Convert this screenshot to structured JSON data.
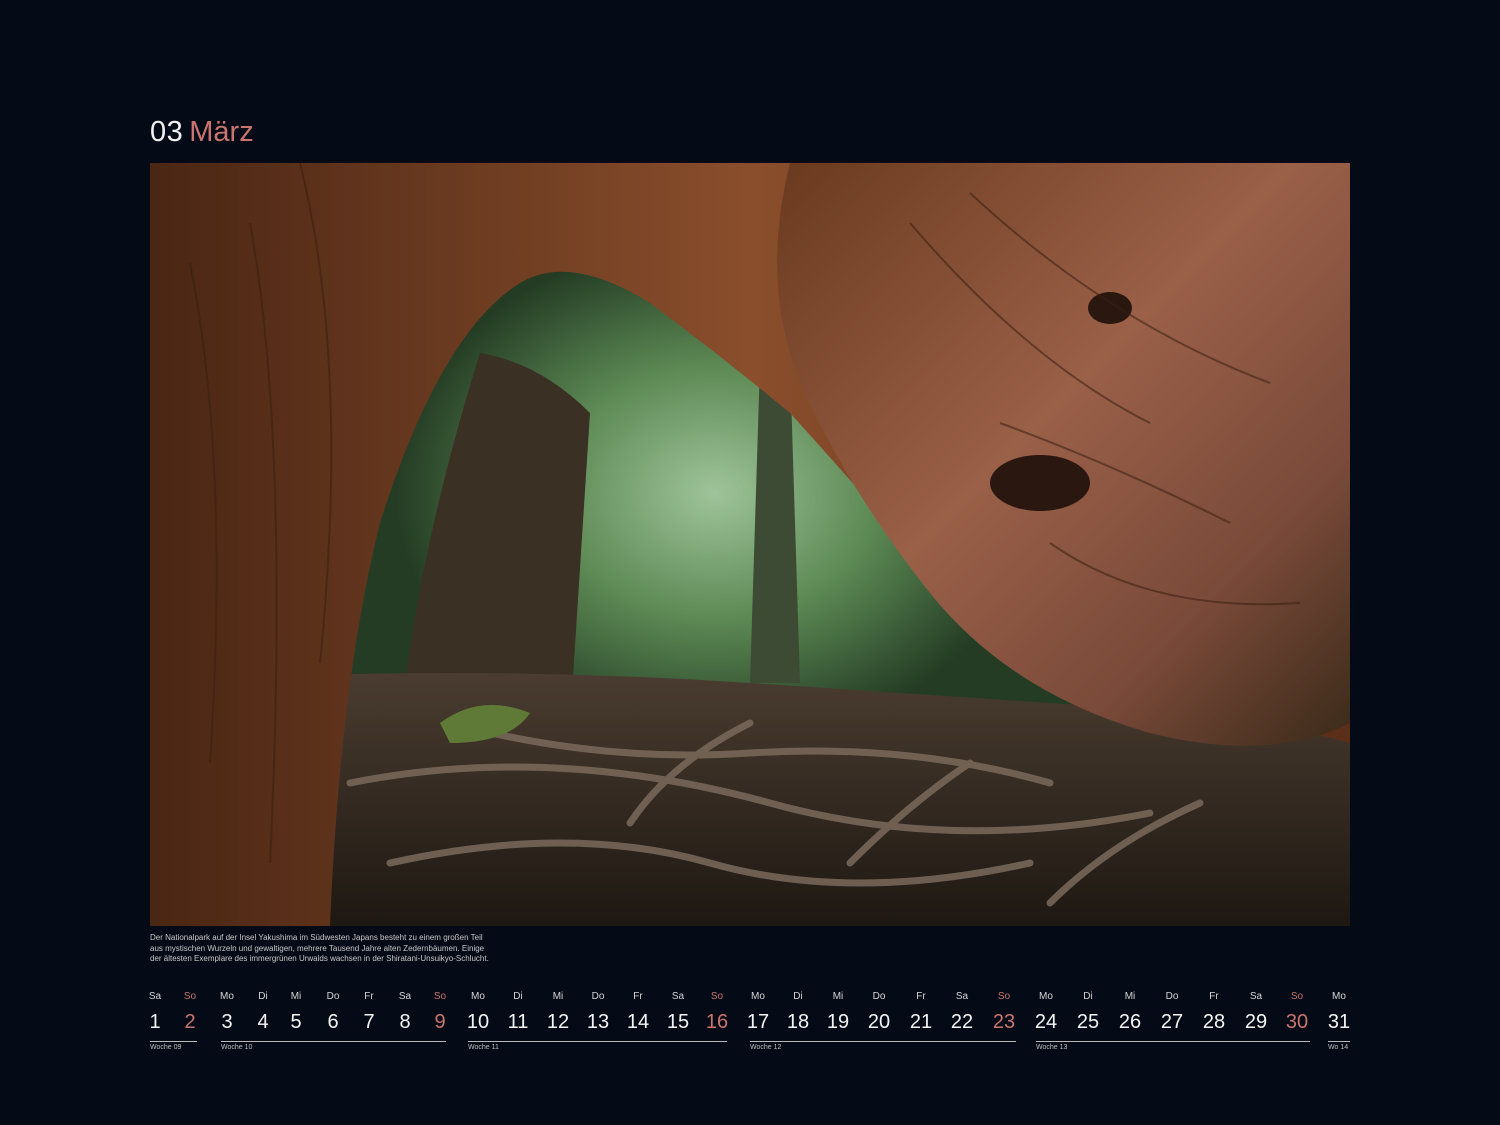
{
  "header": {
    "month_number": "03",
    "month_name": "März"
  },
  "photo": {
    "subject": "giant twisted cedar roots arching over a forest trail",
    "colors": {
      "bark": "#6b3a22",
      "foliage": "#4f7a44",
      "ground": "#3a2c22"
    }
  },
  "caption": [
    "Der Nationalpark auf der Insel Yakushima im Südwesten Japans besteht zu einem großen Teil",
    "aus mystischen Wurzeln und gewaltigen, mehrere Tausend Jahre alten Zedernbäumen. Einige",
    "der ältesten Exemplare des immergrünen Urwalds wachsen in der Shiratani-Unsuikyo-Schlucht."
  ],
  "colors": {
    "background": "#040b17",
    "accent_sunday": "#c9756d",
    "text": "#f4f4f4"
  },
  "calendar": {
    "days": [
      {
        "d": "Sa",
        "n": "1",
        "sun": false
      },
      {
        "d": "So",
        "n": "2",
        "sun": true
      },
      {
        "d": "Mo",
        "n": "3",
        "sun": false
      },
      {
        "d": "Di",
        "n": "4",
        "sun": false
      },
      {
        "d": "Mi",
        "n": "5",
        "sun": false
      },
      {
        "d": "Do",
        "n": "6",
        "sun": false
      },
      {
        "d": "Fr",
        "n": "7",
        "sun": false
      },
      {
        "d": "Sa",
        "n": "8",
        "sun": false
      },
      {
        "d": "So",
        "n": "9",
        "sun": true
      },
      {
        "d": "Mo",
        "n": "10",
        "sun": false
      },
      {
        "d": "Di",
        "n": "11",
        "sun": false
      },
      {
        "d": "Mi",
        "n": "12",
        "sun": false
      },
      {
        "d": "Do",
        "n": "13",
        "sun": false
      },
      {
        "d": "Fr",
        "n": "14",
        "sun": false
      },
      {
        "d": "Sa",
        "n": "15",
        "sun": false
      },
      {
        "d": "So",
        "n": "16",
        "sun": true
      },
      {
        "d": "Mo",
        "n": "17",
        "sun": false
      },
      {
        "d": "Di",
        "n": "18",
        "sun": false
      },
      {
        "d": "Mi",
        "n": "19",
        "sun": false
      },
      {
        "d": "Do",
        "n": "20",
        "sun": false
      },
      {
        "d": "Fr",
        "n": "21",
        "sun": false
      },
      {
        "d": "Sa",
        "n": "22",
        "sun": false
      },
      {
        "d": "So",
        "n": "23",
        "sun": true
      },
      {
        "d": "Mo",
        "n": "24",
        "sun": false
      },
      {
        "d": "Di",
        "n": "25",
        "sun": false
      },
      {
        "d": "Mi",
        "n": "26",
        "sun": false
      },
      {
        "d": "Do",
        "n": "27",
        "sun": false
      },
      {
        "d": "Fr",
        "n": "28",
        "sun": false
      },
      {
        "d": "Sa",
        "n": "29",
        "sun": false
      },
      {
        "d": "So",
        "n": "30",
        "sun": true
      },
      {
        "d": "Mo",
        "n": "31",
        "sun": false
      }
    ],
    "weeks": [
      "Woche 09",
      "Woche 10",
      "Woche 11",
      "Woche 12",
      "Woche 13",
      "Wo 14"
    ]
  }
}
